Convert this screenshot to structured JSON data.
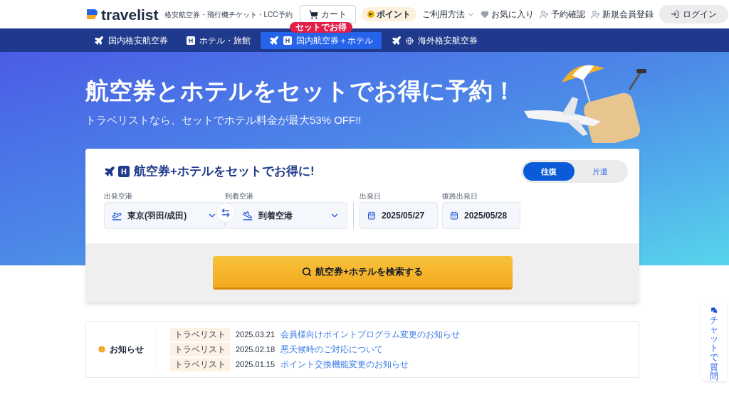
{
  "header": {
    "logo": "travelist",
    "tagline": "格安航空券・飛行機チケット・LCC予約",
    "cart": "カート",
    "points": {
      "coin": "P",
      "label": "ポイント"
    },
    "menu": [
      {
        "kind": "dropdown",
        "label": "ご利用方法"
      },
      {
        "kind": "favorite",
        "label": "お気に入り"
      },
      {
        "kind": "user",
        "label": "予約確認"
      },
      {
        "kind": "user",
        "label": "新規会員登録"
      }
    ],
    "login": "ログイン"
  },
  "nav": {
    "tabs": [
      {
        "kind": "flight",
        "label": "国内格安航空券",
        "selected": false
      },
      {
        "kind": "hotel",
        "mark": "H",
        "label": "ホテル・旅館",
        "selected": false
      },
      {
        "kind": "package",
        "mark": "H",
        "label": "国内航空券＋ホテル",
        "selected": true,
        "badge": "セットでお得"
      },
      {
        "kind": "international",
        "label": "海外格安航空券",
        "selected": false
      }
    ]
  },
  "hero": {
    "title": "航空券とホテルをセットでお得に予約！",
    "subtitle": "トラベリストなら、セットでホテル料金が最大53% OFF!!"
  },
  "search": {
    "mark": "H",
    "title": "航空券+ホテルをセットでお得に!",
    "trip_types": [
      {
        "label": "往復",
        "selected": true
      },
      {
        "label": "片道",
        "selected": false
      }
    ],
    "departure": {
      "label": "出発空港",
      "value": "東京(羽田/成田)"
    },
    "arrival": {
      "label": "到着空港",
      "value": "到着空港"
    },
    "depart_date": {
      "label": "出発日",
      "value": "2025/05/27"
    },
    "return_date": {
      "label": "復路出発日",
      "value": "2025/05/28"
    },
    "button": "航空券+ホテルを検索する"
  },
  "notices": {
    "title": "お知らせ",
    "items": [
      {
        "source": "トラベリスト",
        "date": "2025.03.21",
        "text": "会員様向けポイントプログラム変更のお知らせ"
      },
      {
        "source": "トラベリスト",
        "date": "2025.02.18",
        "text": "悪天候時のご対応について"
      },
      {
        "source": "トラベリスト",
        "date": "2025.01.15",
        "text": "ポイント交換機能変更のお知らせ"
      }
    ]
  },
  "chat": {
    "label": "チャットで質問"
  }
}
